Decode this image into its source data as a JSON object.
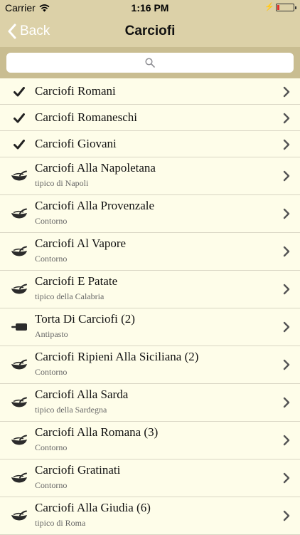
{
  "status_bar": {
    "carrier": "Carrier",
    "time": "1:16 PM"
  },
  "nav": {
    "back_label": "Back",
    "title": "Carciofi"
  },
  "search": {
    "placeholder": ""
  },
  "items": [
    {
      "title": "Carciofi Romani",
      "subtitle": "",
      "icon": "checkmark-icon"
    },
    {
      "title": "Carciofi Romaneschi",
      "subtitle": "",
      "icon": "checkmark-icon"
    },
    {
      "title": "Carciofi Giovani",
      "subtitle": "",
      "icon": "checkmark-icon"
    },
    {
      "title": "Carciofi Alla Napoletana",
      "subtitle": "tipico di Napoli",
      "icon": "dish-icon"
    },
    {
      "title": "Carciofi Alla Provenzale",
      "subtitle": "Contorno",
      "icon": "dish-icon"
    },
    {
      "title": "Carciofi Al Vapore",
      "subtitle": "Contorno",
      "icon": "dish-icon"
    },
    {
      "title": "Carciofi E Patate",
      "subtitle": "tipico della Calabria",
      "icon": "dish-icon"
    },
    {
      "title": "Torta Di Carciofi (2)",
      "subtitle": "Antipasto",
      "icon": "cutting-board-icon"
    },
    {
      "title": "Carciofi Ripieni Alla Siciliana (2)",
      "subtitle": "Contorno",
      "icon": "dish-icon"
    },
    {
      "title": "Carciofi Alla Sarda",
      "subtitle": "tipico della Sardegna",
      "icon": "dish-icon"
    },
    {
      "title": "Carciofi Alla Romana (3)",
      "subtitle": "Contorno",
      "icon": "dish-icon"
    },
    {
      "title": "Carciofi Gratinati",
      "subtitle": "Contorno",
      "icon": "dish-icon"
    },
    {
      "title": "Carciofi Alla Giudia (6)",
      "subtitle": "tipico di Roma",
      "icon": "dish-icon"
    }
  ],
  "colors": {
    "bar": "#dcd1a8",
    "search_bar": "#c9bd91",
    "list_bg": "#fefde9",
    "battery": "#e0302c"
  }
}
